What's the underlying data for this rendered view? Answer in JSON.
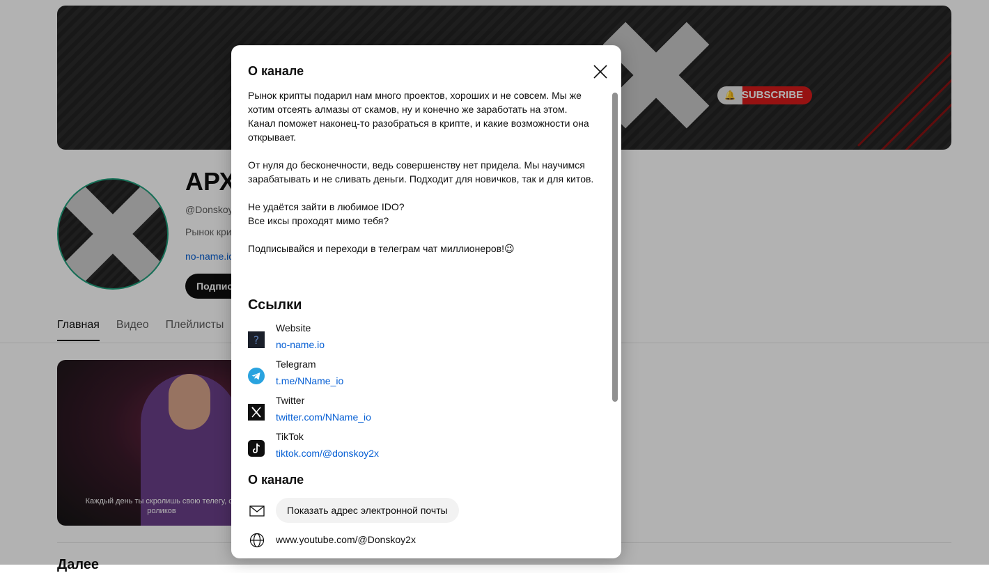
{
  "background": {
    "banner_subscribe_label": "SUBSCRIBE",
    "channel_title": "АРХ",
    "channel_handle": "@Donskoy",
    "channel_desc": "Рынок кри",
    "channel_link": "no-name.ic",
    "subscribe_label": "Подпис",
    "tabs": [
      "Главная",
      "Видео",
      "Плейлисты"
    ],
    "video_caption_line1": "Каждый день ты скролишь свою телегу, см",
    "video_caption_line2": "роликов",
    "bottom_heading": "Далее"
  },
  "modal": {
    "title": "О канале",
    "about_paragraphs": [
      "Рынок крипты подарил нам много проектов, хороших и не совсем. Мы же хотим отсеять алмазы от скамов, ну и конечно же заработать на этом. Канал поможет наконец-то разобраться в крипте, и какие возможности она открывает.",
      "От нуля до бесконечности, ведь совершенству нет придела. Мы научимся зарабатывать и не сливать деньги. Подходит для новичков, так и для китов.",
      "Не удаётся зайти в любимое IDO?\nВсе иксы проходят мимо тебя?",
      "Подписывайся и переходи в телеграм чат миллионеров!😉"
    ],
    "links_title": "Ссылки",
    "links": [
      {
        "name": "Website",
        "url": "no-name.io",
        "icon": "website-icon"
      },
      {
        "name": "Telegram",
        "url": "t.me/NName_io",
        "icon": "telegram-icon"
      },
      {
        "name": "Twitter",
        "url": "twitter.com/NName_io",
        "icon": "twitter-icon"
      },
      {
        "name": "TikTok",
        "url": "tiktok.com/@donskoy2x",
        "icon": "tiktok-icon"
      }
    ],
    "about2_title": "О канале",
    "email_button": "Показать адрес электронной почты",
    "channel_url": "www.youtube.com/@Donskoy2x"
  },
  "colors": {
    "link": "#065fd4",
    "telegram": "#2aa3df",
    "subscribe": "#d71b1b"
  }
}
